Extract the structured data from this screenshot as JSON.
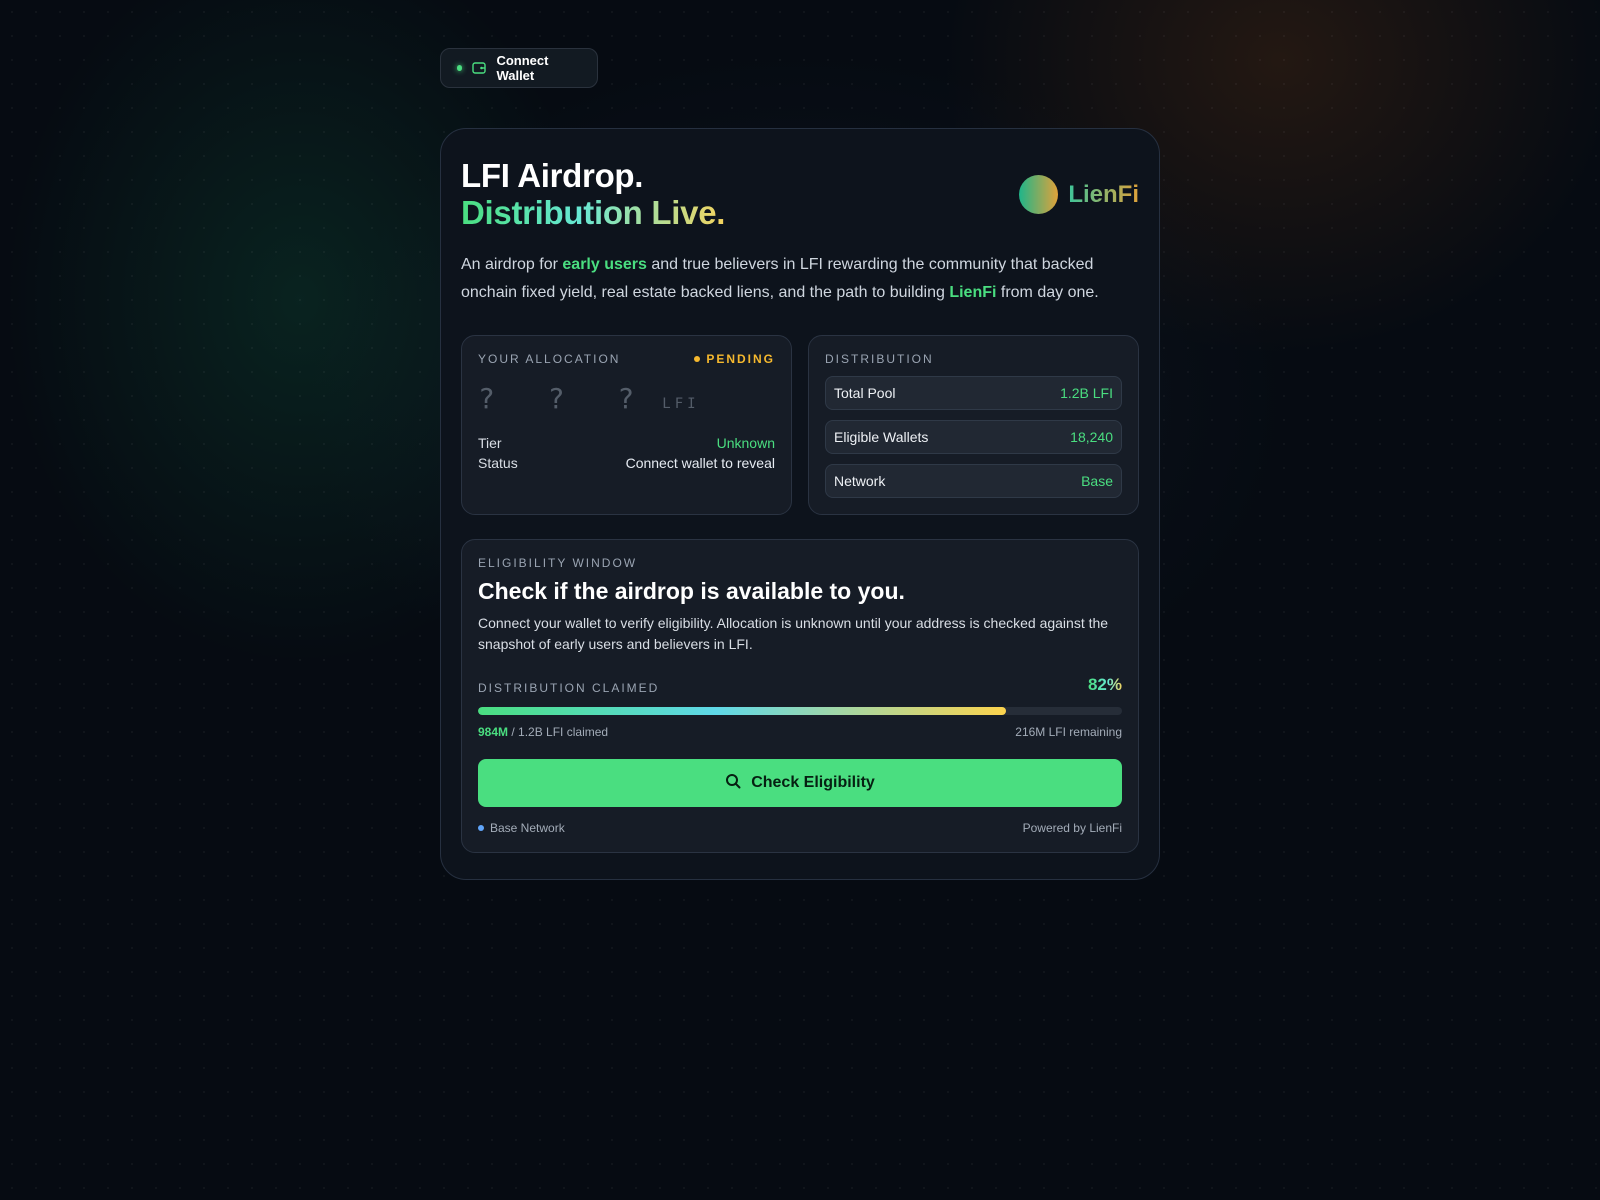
{
  "wallet_button": {
    "label": "Connect Wallet"
  },
  "header": {
    "title_line1": "LFI Airdrop.",
    "title_line2": "Distribution Live.",
    "brand_name": "LienFi"
  },
  "description": {
    "part1": "An airdrop for ",
    "highlight1": "early users",
    "part2": " and true believers in LFI rewarding the community that backed onchain fixed yield, real estate backed liens, and the path to building ",
    "highlight2": "LienFi",
    "part3": " from day one."
  },
  "allocation": {
    "label": "YOUR ALLOCATION",
    "status_badge": "PENDING",
    "amount": "? ? ?",
    "unit": "LFI",
    "tier_label": "Tier",
    "tier_value": "Unknown",
    "status_label": "Status",
    "status_value": "Connect wallet to reveal"
  },
  "distribution": {
    "label": "DISTRIBUTION",
    "items": [
      {
        "key": "Total Pool",
        "value": "1.2B LFI"
      },
      {
        "key": "Eligible Wallets",
        "value": "18,240"
      },
      {
        "key": "Network",
        "value": "Base"
      }
    ]
  },
  "eligibility": {
    "label": "ELIGIBILITY WINDOW",
    "title": "Check if the airdrop is available to you.",
    "description": "Connect your wallet to verify eligibility. Allocation is unknown until your address is checked against the snapshot of early users and believers in LFI.",
    "claimed_label": "DISTRIBUTION CLAIMED",
    "claimed_percent_text": "82%",
    "claimed_fraction": 0.82,
    "claimed_amount": "984M",
    "claimed_total": " / 1.2B LFI claimed",
    "remaining": "216M LFI remaining",
    "cta_label": "Check Eligibility",
    "network_label": "Base Network",
    "powered_by": "Powered by LienFi"
  },
  "colors": {
    "accent_green": "#4ade80",
    "pending_amber": "#f5b82e",
    "network_blue": "#60a5fa",
    "background": "#060b12"
  },
  "icons": {
    "wallet": "wallet-icon",
    "search": "search-icon"
  }
}
